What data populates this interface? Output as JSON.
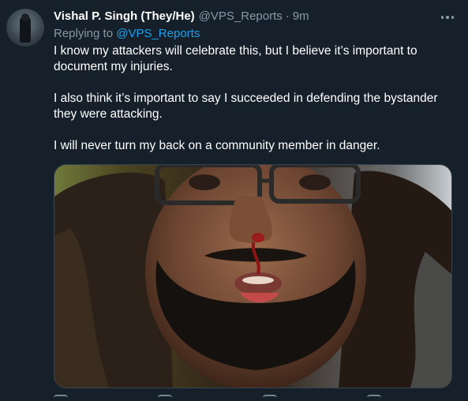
{
  "tweet": {
    "display_name": "Vishal P. Singh (They/He)",
    "handle": "@VPS_Reports",
    "separator": "·",
    "time": "9m",
    "replying_prefix": "Replying to ",
    "replying_to": "@VPS_Reports",
    "paragraphs": [
      "I know my attackers will celebrate this, but I believe it’s important to document my injuries.",
      "I also think it’s important to say I succeeded in defending the bystander they were attacking.",
      "I will never turn my back on a community member in danger."
    ]
  },
  "icons": {
    "more": "more-horizontal-icon",
    "reply": "reply-icon",
    "retweet": "retweet-icon",
    "like": "heart-icon",
    "share": "share-icon"
  },
  "colors": {
    "background": "#15202b",
    "primary_text": "#ffffff",
    "secondary_text": "#8899a6",
    "link": "#1da1f2"
  }
}
